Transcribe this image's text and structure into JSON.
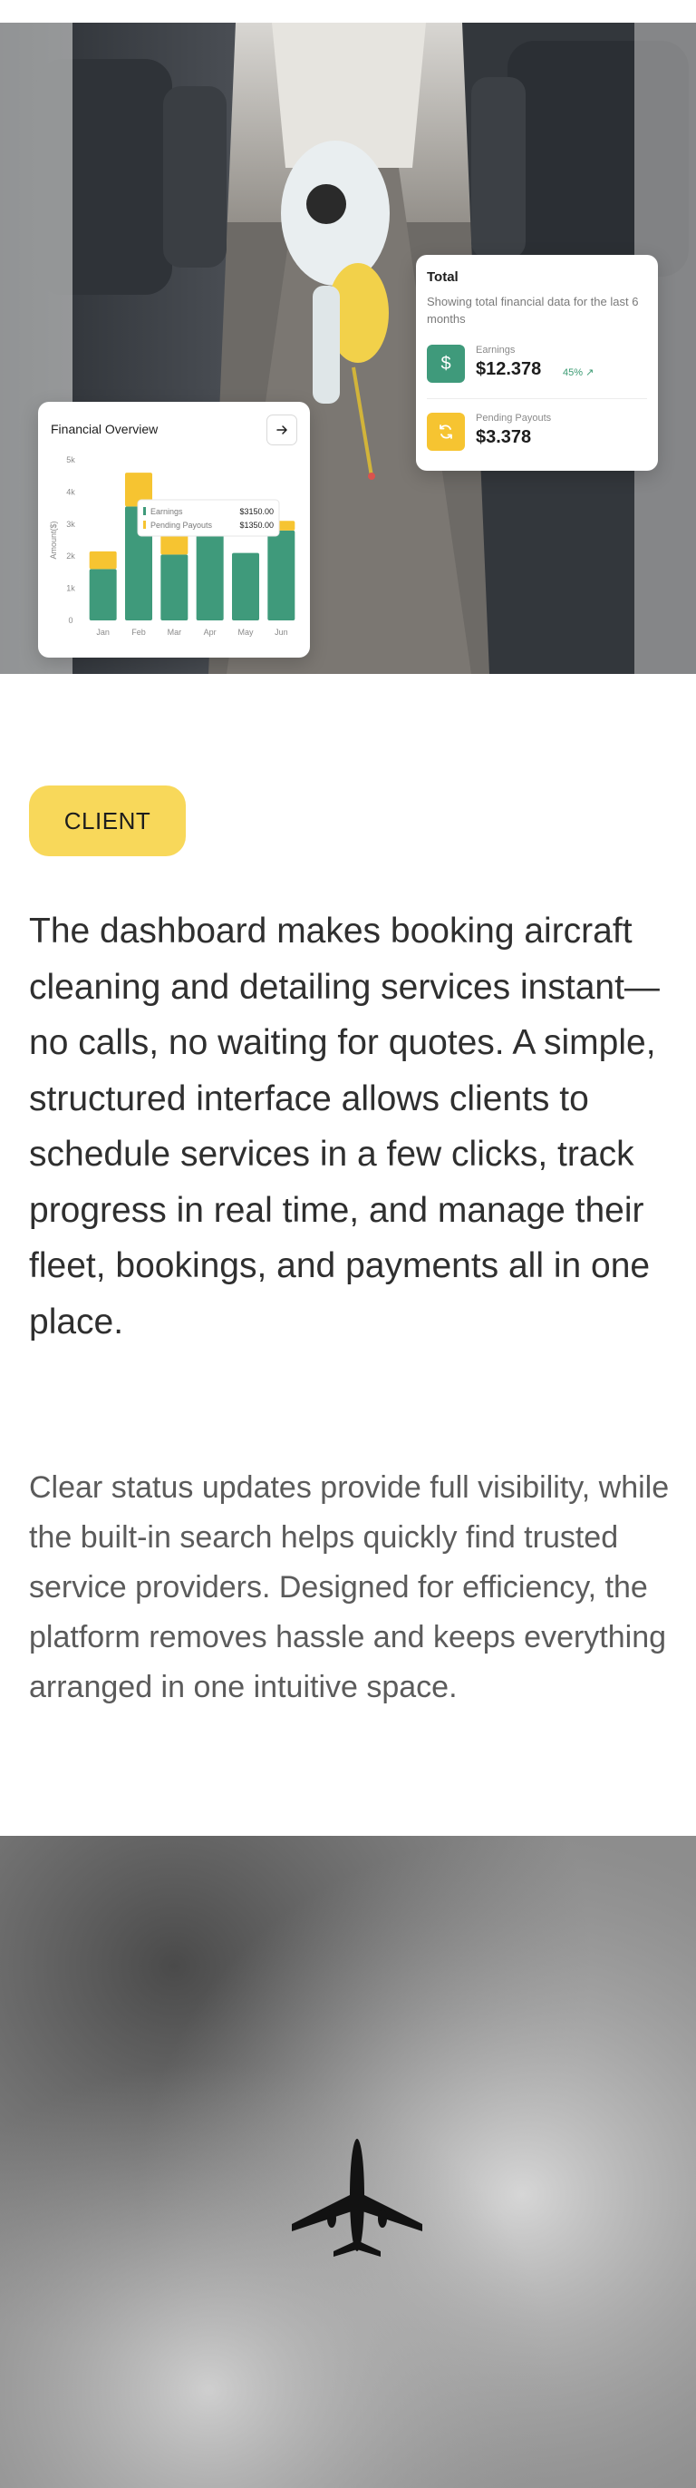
{
  "hero": {
    "image_desc": "bus-interior-cleaning-photo",
    "financial_overview": {
      "title": "Financial Overview",
      "tooltip": {
        "earnings_label": "Earnings",
        "earnings_value": "$3150.00",
        "payouts_label": "Pending Payouts",
        "payouts_value": "$1350.00"
      }
    },
    "total_card": {
      "title": "Total",
      "subtitle": "Showing total financial data for the last 6 months",
      "earnings_label": "Earnings",
      "earnings_value": "$12.378",
      "earnings_change": "45% ↗",
      "payouts_label": "Pending Payouts",
      "payouts_value": "$3.378"
    }
  },
  "chart_data": {
    "type": "bar",
    "title": "Financial Overview",
    "ylabel": "Amount($)",
    "ylim": [
      0,
      5000
    ],
    "y_ticks": [
      "0",
      "1k",
      "2k",
      "3k",
      "4k",
      "5k"
    ],
    "categories": [
      "Jan",
      "Feb",
      "Mar",
      "Apr",
      "May",
      "Jun"
    ],
    "series": [
      {
        "name": "Earnings",
        "values": [
          1600,
          3550,
          2050,
          2800,
          2100,
          2800
        ]
      },
      {
        "name": "Pending Payouts",
        "values": [
          550,
          1050,
          650,
          750,
          0,
          300
        ]
      }
    ]
  },
  "content": {
    "tag": "CLIENT",
    "lead": "The dashboard makes booking aircraft cleaning and detailing services instant—no calls, no waiting for quotes. A simple, structured interface allows clients to schedule services in a few clicks, track progress in real time, and manage their fleet, bookings, and payments all in one place.",
    "body": "Clear status updates provide full visibility, while the built-in search helps quickly find trusted service providers. Designed for efficiency, the platform removes hassle and keeps everything arranged in one intuitive space."
  },
  "colors": {
    "earnings": "#3f9a7b",
    "payouts": "#f6c431",
    "tag": "#f8d85a"
  },
  "icons": {
    "arrow": "arrow-right-icon",
    "dollar": "dollar-icon",
    "refresh": "refresh-icon",
    "plane": "airplane-icon"
  }
}
